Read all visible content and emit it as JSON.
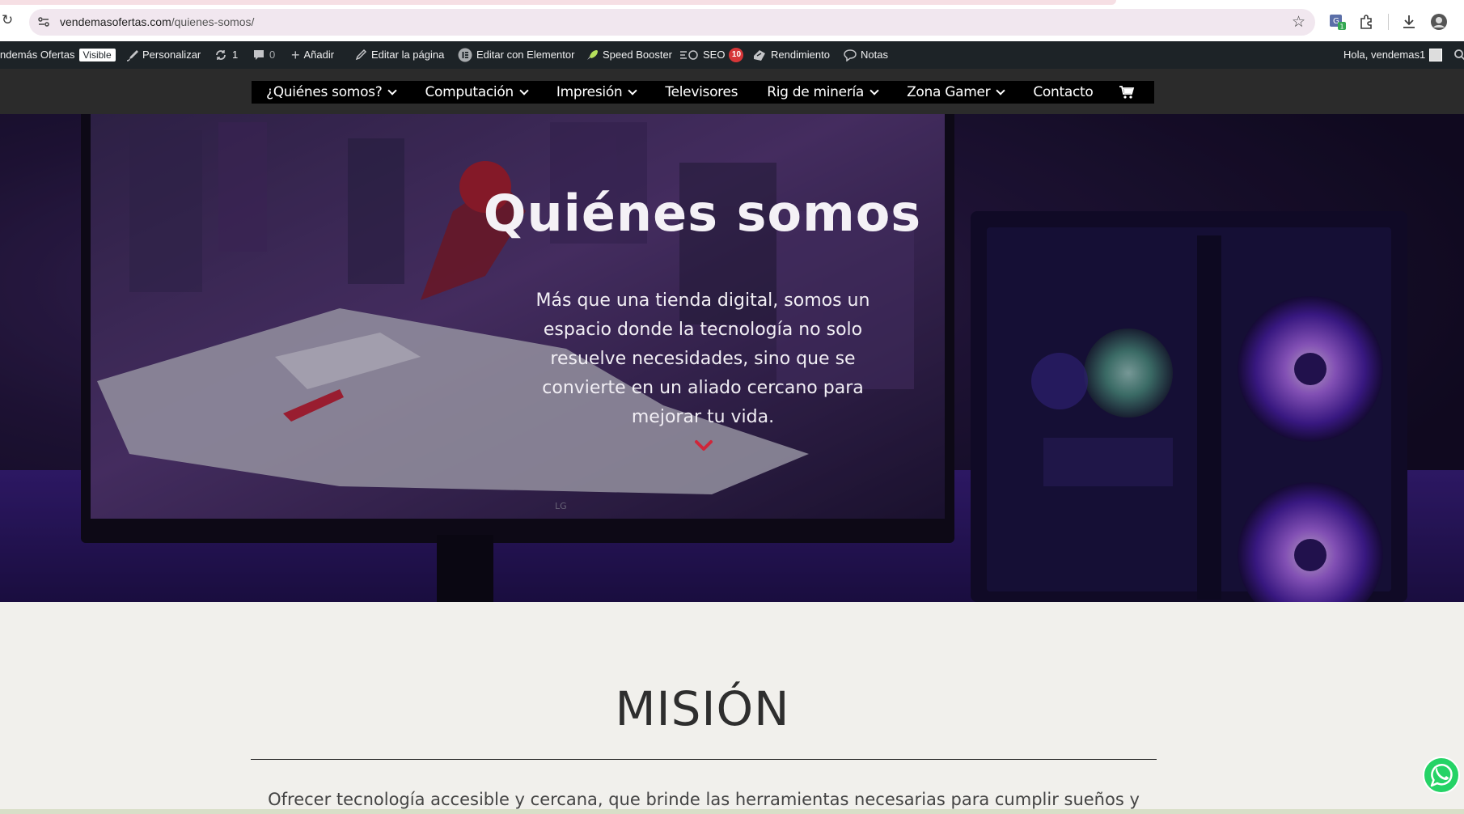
{
  "browser": {
    "url_domain": "vendemasofertas.com",
    "url_path": "/quienes-somos/",
    "extension_badge": "1"
  },
  "adminbar": {
    "site_name": "ndemás Ofertas",
    "visible_badge": "Visible",
    "customize": "Personalizar",
    "updates_count": "1",
    "comments_count": "0",
    "add_new": "Añadir",
    "edit_page": "Editar la página",
    "edit_elementor": "Editar con Elementor",
    "speed_booster": "Speed Booster",
    "seo": "SEO",
    "seo_count": "10",
    "performance": "Rendimiento",
    "notes": "Notas",
    "greeting": "Hola, vendemas1"
  },
  "nav": {
    "items": [
      {
        "label": "¿Quiénes somos?",
        "has_dropdown": true
      },
      {
        "label": "Computación",
        "has_dropdown": true
      },
      {
        "label": "Impresión",
        "has_dropdown": true
      },
      {
        "label": "Televisores",
        "has_dropdown": false
      },
      {
        "label": "Rig de minería",
        "has_dropdown": true
      },
      {
        "label": "Zona Gamer",
        "has_dropdown": true
      },
      {
        "label": "Contacto",
        "has_dropdown": false
      }
    ]
  },
  "hero": {
    "title": "Quiénes somos",
    "text": "Más que una tienda digital, somos un espacio donde la tecnología no solo resuelve necesidades, sino que se convierte en un aliado cercano para mejorar tu vida.",
    "monitor_brand": "LG"
  },
  "mission": {
    "title": "MISIÓN",
    "text": "Ofrecer tecnología accesible y cercana, que brinde las herramientas necesarias para cumplir sueños y"
  },
  "colors": {
    "accent_red": "#d0263a",
    "admin_bar": "#1d2327",
    "header_bg": "#2b2b2b",
    "page_bg": "#f1f0ec",
    "whatsapp_green": "#25d366"
  }
}
